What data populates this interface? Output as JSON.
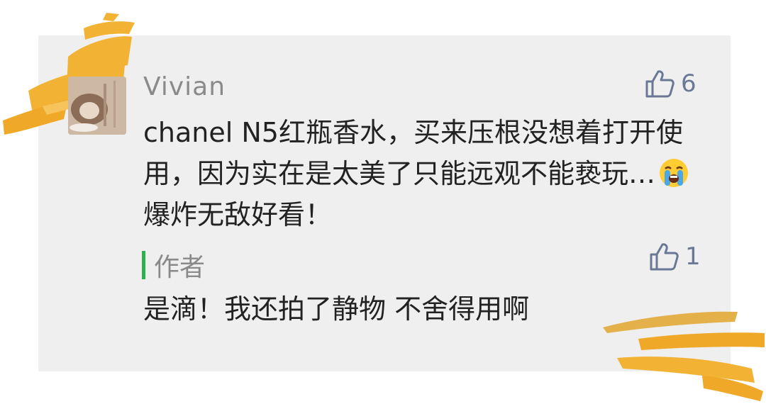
{
  "comment": {
    "username": "Vivian",
    "like_count": "6",
    "text_before_emoji": "chanel N5红瓶香水，买来压根没想着打开使用，因为实在是太美了只能远观不能亵玩…",
    "emoji": "loudly-crying-face",
    "text_after_emoji": "爆炸无敌好看！"
  },
  "reply": {
    "author_label": "作者",
    "like_count": "1",
    "text": "是滴！我还拍了静物 不舍得用啊"
  },
  "colors": {
    "card_bg": "#efefef",
    "name_gray": "#8a8a8a",
    "like_blue": "#6a7896",
    "author_bar_green": "#2bb24c",
    "brush_yellow": "#f2b233"
  }
}
